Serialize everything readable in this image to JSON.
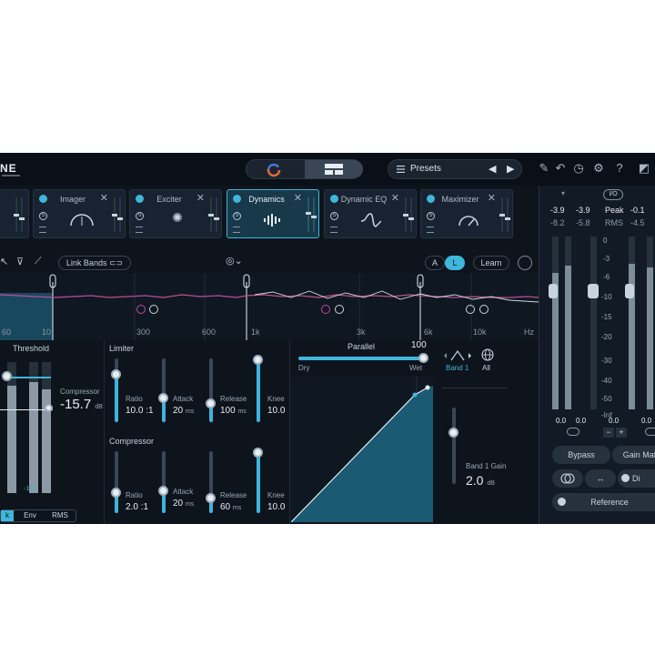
{
  "app": {
    "logo_text": "NE"
  },
  "topbar": {
    "presets_label": "Presets"
  },
  "modules": [
    {
      "name": ""
    },
    {
      "name": "Imager"
    },
    {
      "name": "Exciter"
    },
    {
      "name": "Dynamics"
    },
    {
      "name": "Dynamic EQ"
    },
    {
      "name": "Maximizer"
    }
  ],
  "toolbar": {
    "link_bands": "Link Bands",
    "a_label": "A",
    "l_label": "L",
    "learn": "Learn"
  },
  "spectrum": {
    "freq_labels": [
      "60",
      "10",
      "300",
      "600",
      "1k",
      "3k",
      "6k",
      "10k",
      "Hz"
    ]
  },
  "threshold": {
    "title": "Threshold",
    "compressor_label": "Compressor",
    "compressor_value": "-15.7",
    "compressor_unit": "dB",
    "readout": "-1.8",
    "tabs": [
      "k",
      "Env",
      "RMS"
    ]
  },
  "limiter": {
    "title": "Limiter",
    "params": [
      {
        "label": "Ratio",
        "value": "10.0 :1",
        "unit": ""
      },
      {
        "label": "Attack",
        "value": "20",
        "unit": "ms"
      },
      {
        "label": "Release",
        "value": "100",
        "unit": "ms"
      },
      {
        "label": "Knee",
        "value": "10.0",
        "unit": ""
      }
    ]
  },
  "compressor": {
    "title": "Compressor",
    "params": [
      {
        "label": "Ratio",
        "value": "2.0 :1",
        "unit": ""
      },
      {
        "label": "Attack",
        "value": "20",
        "unit": "ms"
      },
      {
        "label": "Release",
        "value": "60",
        "unit": "ms"
      },
      {
        "label": "Knee",
        "value": "10.0",
        "unit": ""
      }
    ]
  },
  "parallel": {
    "title": "Parallel",
    "value": "100",
    "dry": "Dry",
    "wet": "Wet"
  },
  "band": {
    "band_label": "Band 1",
    "all_label": "All",
    "gain_label": "Band 1 Gain",
    "gain_value": "2.0",
    "gain_unit": "dB"
  },
  "meters": {
    "in_left": "-3.9",
    "in_right": "-3.9",
    "peak_label": "Peak",
    "out_left": "-0.1",
    "in_rms_left": "-8.2",
    "in_rms_right": "-5.8",
    "rms_label": "RMS",
    "out_rms": "-4.5",
    "scale": [
      "0",
      "-3",
      "-6",
      "-10",
      "-15",
      "-20",
      "-30",
      "-40",
      "-50",
      "-Inf"
    ],
    "bottom_left": "0.0",
    "bottom_mid": "0.0",
    "bottom_right": "0.0",
    "bottom_far": "0.0",
    "bypass": "Bypass",
    "gain_match": "Gain Mat",
    "dither": "Di",
    "reference": "Reference"
  },
  "colors": {
    "accent": "#3fb6dc",
    "background": "#0d141c"
  }
}
